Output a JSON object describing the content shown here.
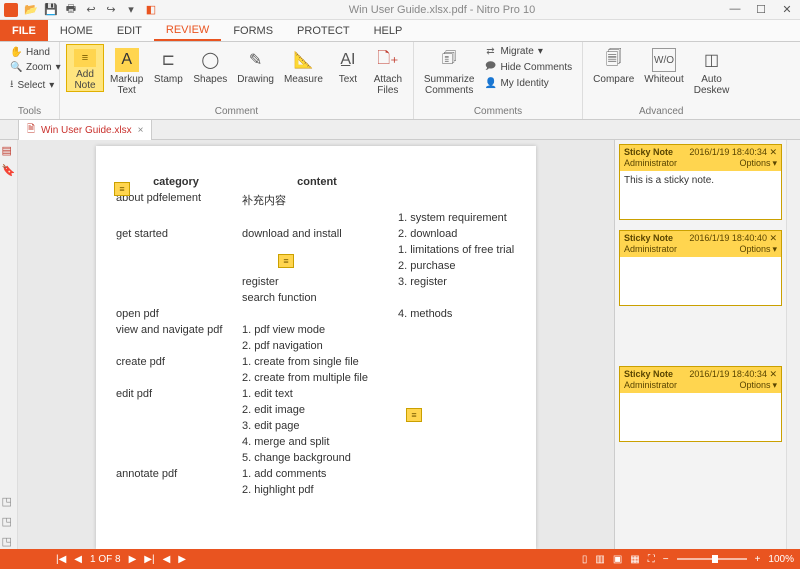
{
  "title": "Win User Guide.xlsx.pdf - Nitro Pro 10",
  "tabs": {
    "file": "FILE",
    "home": "HOME",
    "edit": "EDIT",
    "review": "REVIEW",
    "forms": "FORMS",
    "protect": "PROTECT",
    "help": "HELP"
  },
  "tools": {
    "hand": "Hand",
    "zoom": "Zoom",
    "select": "Select",
    "label": "Tools"
  },
  "ribbon": {
    "addNote": "Add\nNote",
    "markup": "Markup\nText",
    "stamp": "Stamp",
    "shapes": "Shapes",
    "drawing": "Drawing",
    "measure": "Measure",
    "text": "Text",
    "attach": "Attach\nFiles",
    "commentGroup": "Comment",
    "summarize": "Summarize\nComments",
    "migrate": "Migrate",
    "hideComments": "Hide Comments",
    "myIdentity": "My Identity",
    "commentsGroup": "Comments",
    "compare": "Compare",
    "whiteout": "Whiteout",
    "autoDeskew": "Auto\nDeskew",
    "advancedGroup": "Advanced"
  },
  "docTab": "Win User Guide.xlsx",
  "page": {
    "h_category": "category",
    "h_content": "content",
    "rows": [
      [
        "about pdfelement",
        "补充内容",
        ""
      ],
      [
        "",
        "",
        "1. system requirement"
      ],
      [
        "get started",
        "download and install",
        "2. download"
      ],
      [
        "",
        "",
        "1. limitations of free trial"
      ],
      [
        "",
        "",
        "2. purchase"
      ],
      [
        "",
        "register",
        "3. register"
      ],
      [
        "",
        "search function",
        ""
      ],
      [
        "open pdf",
        "",
        "4. methods"
      ],
      [
        "view and navigate pdf",
        "1. pdf view mode",
        ""
      ],
      [
        "",
        "2. pdf navigation",
        ""
      ],
      [
        "create pdf",
        "1. create from single file",
        ""
      ],
      [
        "",
        "2. create from multiple file",
        ""
      ],
      [
        "edit pdf",
        "1. edit text",
        ""
      ],
      [
        "",
        "2. edit image",
        ""
      ],
      [
        "",
        "3. edit page",
        ""
      ],
      [
        "",
        "4. merge and split",
        ""
      ],
      [
        "",
        "5. change background",
        ""
      ],
      [
        "annotate pdf",
        "1. add comments",
        ""
      ],
      [
        "",
        "2. highlight pdf",
        ""
      ]
    ]
  },
  "sticky": [
    {
      "title": "Sticky Note",
      "date": "2016/1/19 18:40:34",
      "author": "Administrator",
      "options": "Options",
      "body": "This is a sticky note."
    },
    {
      "title": "Sticky Note",
      "date": "2016/1/19 18:40:40",
      "author": "Administrator",
      "options": "Options",
      "body": ""
    },
    {
      "title": "Sticky Note",
      "date": "2016/1/19 18:40:34",
      "author": "Administrator",
      "options": "Options",
      "body": ""
    }
  ],
  "status": {
    "page": "1 OF 8",
    "zoom": "100%"
  }
}
